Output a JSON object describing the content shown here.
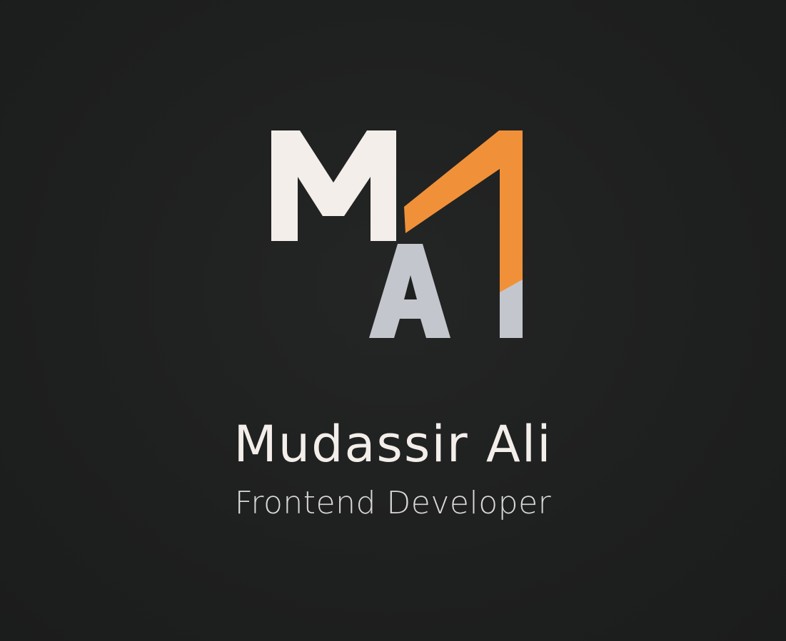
{
  "brand": {
    "name": "Mudassir Ali",
    "role": "Frontend Developer",
    "monogram_letters": "MA1"
  },
  "colors": {
    "background": "#1f2020",
    "letter_m": "#f3eeea",
    "letter_a": "#c3c7cd",
    "accent_orange": "#f0913a",
    "accent_gray": "#c3c7cd",
    "name_text": "#f3eeea",
    "role_text": "#d8d8d6"
  }
}
